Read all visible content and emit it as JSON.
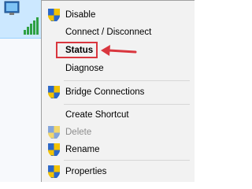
{
  "menu": {
    "items": [
      {
        "label": "Disable",
        "shield": true,
        "disabled": false,
        "bold": false
      },
      {
        "label": "Connect / Disconnect",
        "shield": false,
        "disabled": false,
        "bold": false
      },
      {
        "label": "Status",
        "shield": false,
        "disabled": false,
        "bold": true
      },
      {
        "label": "Diagnose",
        "shield": false,
        "disabled": false,
        "bold": false
      },
      {
        "label": "Bridge Connections",
        "shield": true,
        "disabled": false,
        "bold": false
      },
      {
        "label": "Create Shortcut",
        "shield": false,
        "disabled": false,
        "bold": false
      },
      {
        "label": "Delete",
        "shield": true,
        "disabled": true,
        "bold": false
      },
      {
        "label": "Rename",
        "shield": true,
        "disabled": false,
        "bold": false
      },
      {
        "label": "Properties",
        "shield": true,
        "disabled": false,
        "bold": false
      }
    ]
  },
  "annotation": {
    "highlight_color": "#d9363e",
    "target": "Status"
  },
  "icons": {
    "network": "network-adapter-icon",
    "shield": "uac-shield-icon",
    "arrow": "red-arrow-icon"
  }
}
